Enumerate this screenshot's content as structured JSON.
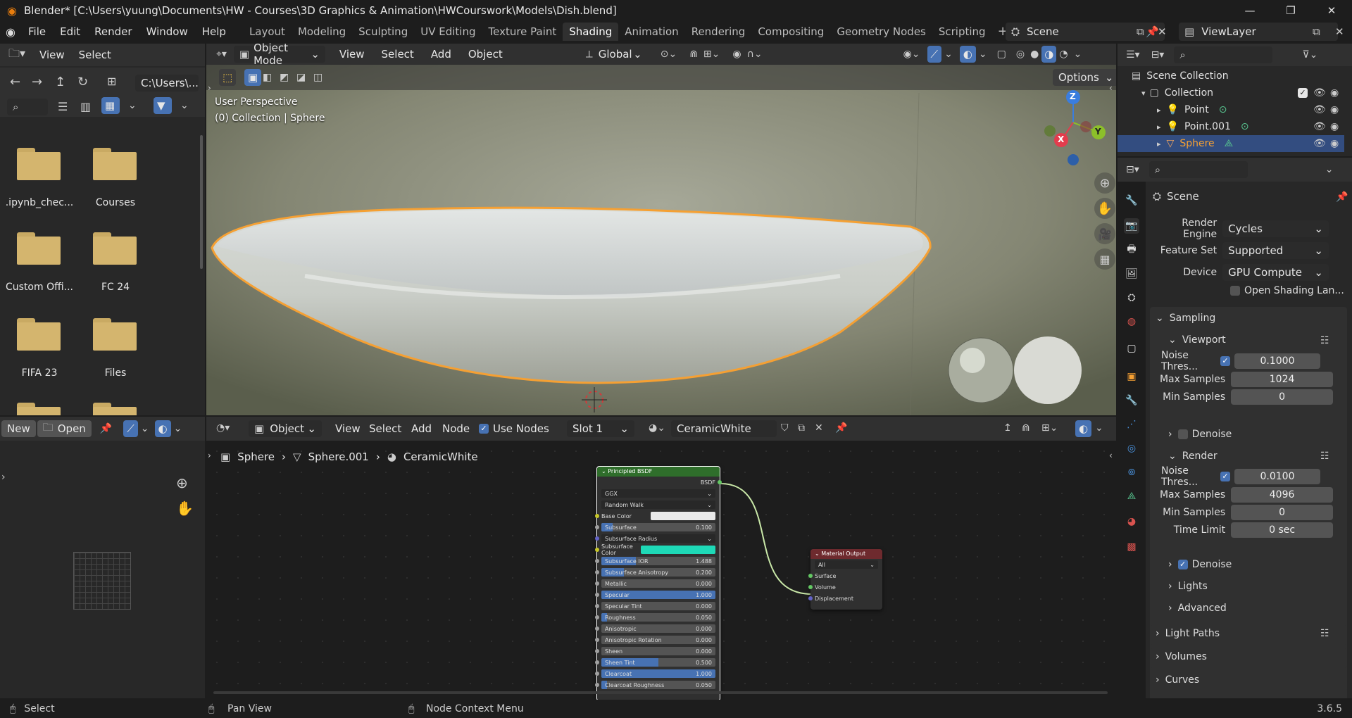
{
  "window": {
    "title": "Blender* [C:\\Users\\yuung\\Documents\\HW - Courses\\3D Graphics & Animation\\HWCourswork\\Models\\Dish.blend]"
  },
  "menu": {
    "items": [
      "File",
      "Edit",
      "Render",
      "Window",
      "Help"
    ]
  },
  "workspaces": {
    "tabs": [
      "Layout",
      "Modeling",
      "Sculpting",
      "UV Editing",
      "Texture Paint",
      "Shading",
      "Animation",
      "Rendering",
      "Compositing",
      "Geometry Nodes",
      "Scripting"
    ],
    "active": "Shading"
  },
  "scene": {
    "name": "Scene",
    "view_layer": "ViewLayer"
  },
  "file_browser": {
    "menu": [
      "View",
      "Select"
    ],
    "path": "C:\\Users\\...",
    "folders": [
      ".ipynb_chec...",
      "Courses",
      "Custom Offi...",
      "FC 24",
      "FIFA 23",
      "Files"
    ]
  },
  "image_editor": {
    "new_label": "New",
    "open_label": "Open"
  },
  "viewport": {
    "mode": "Object Mode",
    "menu": [
      "View",
      "Select",
      "Add",
      "Object"
    ],
    "orientation": "Global",
    "options_label": "Options",
    "perspective": "User Perspective",
    "context": "(0) Collection | Sphere",
    "axes": {
      "x": "X",
      "y": "Y",
      "z": "Z"
    }
  },
  "node_editor": {
    "type": "Object",
    "menu": [
      "View",
      "Select",
      "Add",
      "Node"
    ],
    "use_nodes_label": "Use Nodes",
    "slot": "Slot 1",
    "material": "CeramicWhite",
    "breadcrumb": [
      "Sphere",
      "Sphere.001",
      "CeramicWhite"
    ],
    "bsdf": {
      "title": "Principled BSDF",
      "output_label": "BSDF",
      "distribution": "GGX",
      "subsurface_method": "Random Walk",
      "base_color_label": "Base Color",
      "base_color": "#e8e8e8",
      "subsurface_color_label": "Subsurface Color",
      "subsurface_color": "#1ed9b7",
      "subsurface_radius_label": "Subsurface Radius",
      "fields": [
        {
          "label": "Subsurface",
          "value": "0.100",
          "fill": 0.1
        },
        {
          "label": "Subsurface IOR",
          "value": "1.488",
          "fill": 0.3
        },
        {
          "label": "Subsurface Anisotropy",
          "value": "0.200",
          "fill": 0.2
        },
        {
          "label": "Metallic",
          "value": "0.000",
          "fill": 0
        },
        {
          "label": "Specular",
          "value": "1.000",
          "fill": 1
        },
        {
          "label": "Specular Tint",
          "value": "0.000",
          "fill": 0
        },
        {
          "label": "Roughness",
          "value": "0.050",
          "fill": 0.05
        },
        {
          "label": "Anisotropic",
          "value": "0.000",
          "fill": 0
        },
        {
          "label": "Anisotropic Rotation",
          "value": "0.000",
          "fill": 0
        },
        {
          "label": "Sheen",
          "value": "0.000",
          "fill": 0
        },
        {
          "label": "Sheen Tint",
          "value": "0.500",
          "fill": 0.5
        },
        {
          "label": "Clearcoat",
          "value": "1.000",
          "fill": 1
        },
        {
          "label": "Clearcoat Roughness",
          "value": "0.050",
          "fill": 0.05
        }
      ]
    },
    "output": {
      "title": "Material Output",
      "target": "All",
      "sockets": [
        "Surface",
        "Volume",
        "Displacement"
      ]
    }
  },
  "outliner": {
    "root": "Scene Collection",
    "collection": "Collection",
    "items": [
      "Point",
      "Point.001",
      "Sphere"
    ],
    "selected": "Sphere"
  },
  "properties": {
    "context": "Scene",
    "render_engine_label": "Render Engine",
    "render_engine": "Cycles",
    "feature_set_label": "Feature Set",
    "feature_set": "Supported",
    "device_label": "Device",
    "device": "GPU Compute",
    "osl_label": "Open Shading Lan...",
    "sampling_label": "Sampling",
    "viewport_label": "Viewport",
    "render_label": "Render",
    "noise_label": "Noise Thres...",
    "max_samples_label": "Max Samples",
    "min_samples_label": "Min Samples",
    "time_limit_label": "Time Limit",
    "viewport_noise": "0.1000",
    "viewport_max": "1024",
    "viewport_min": "0",
    "render_noise": "0.0100",
    "render_max": "4096",
    "render_min": "0",
    "time_limit": "0 sec",
    "denoise_label": "Denoise",
    "lights_label": "Lights",
    "advanced_label": "Advanced",
    "light_paths_label": "Light Paths",
    "volumes_label": "Volumes",
    "curves_label": "Curves"
  },
  "status": {
    "select": "Select",
    "pan": "Pan View",
    "context_menu": "Node Context Menu",
    "version": "3.6.5"
  },
  "colors": {
    "accent": "#4772b3",
    "selection_outline": "#f5a033",
    "bsdf_header": "#2f6e2b",
    "output_header": "#6e2a2e"
  }
}
